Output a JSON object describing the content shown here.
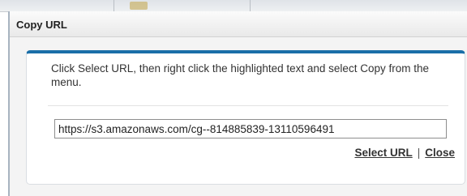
{
  "dialog": {
    "title": "Copy URL",
    "instructions": "Click Select URL, then right click the highlighted text and select Copy from the menu.",
    "url_value": "https://s3.amazonaws.com/cg--814885839-13110596491",
    "actions": {
      "select_url_label": "Select URL",
      "separator": "|",
      "close_label": "Close"
    }
  },
  "colors": {
    "accent": "#1a6fa8",
    "header_bg": "#f0f0f0",
    "panel_bg": "#ffffff"
  }
}
